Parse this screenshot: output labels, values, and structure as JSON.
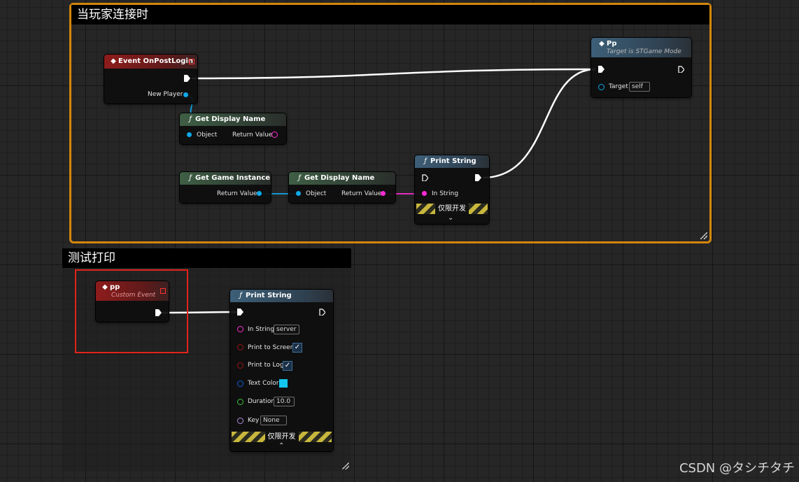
{
  "comments": [
    {
      "title": "当玩家连接时"
    },
    {
      "title": "测试打印"
    }
  ],
  "nodes": {
    "event_onpostlogin": {
      "title": "Event OnPostLogin",
      "new_player": "New Player"
    },
    "get_display_name_1": {
      "title": "Get Display Name",
      "object": "Object",
      "return_value": "Return Value"
    },
    "get_game_instance": {
      "title": "Get Game Instance",
      "return_value": "Return Value"
    },
    "get_display_name_2": {
      "title": "Get Display Name",
      "object": "Object",
      "return_value": "Return Value"
    },
    "print_string_1": {
      "title": "Print String",
      "in_string": "In String",
      "dev_only": "仅限开发"
    },
    "pp_call": {
      "title": "Pp",
      "subtitle": "Target is STGame Mode",
      "target": "Target",
      "target_value": "self"
    },
    "pp_event": {
      "title": "pp",
      "subtitle": "Custom Event"
    },
    "print_string_2": {
      "title": "Print String",
      "in_string": "In String",
      "in_string_value": "server",
      "print_to_screen": "Print to Screen",
      "print_to_log": "Print to Log",
      "text_color": "Text Color",
      "text_color_value": "#12c6ee",
      "duration": "Duration",
      "duration_value": "10.0",
      "key": "Key",
      "key_value": "None",
      "dev_only": "仅限开发"
    }
  },
  "colors": {
    "comment_border_selected": "#d4860b",
    "event_header": "#8e1c1c",
    "func_header": "#3f5f45",
    "print_header": "#3d5f78",
    "object_pin": "#0fa8e8",
    "string_pin": "#ff2bd6",
    "highlight_box": "#e2241b"
  },
  "watermark": "CSDN @タシチタチ"
}
